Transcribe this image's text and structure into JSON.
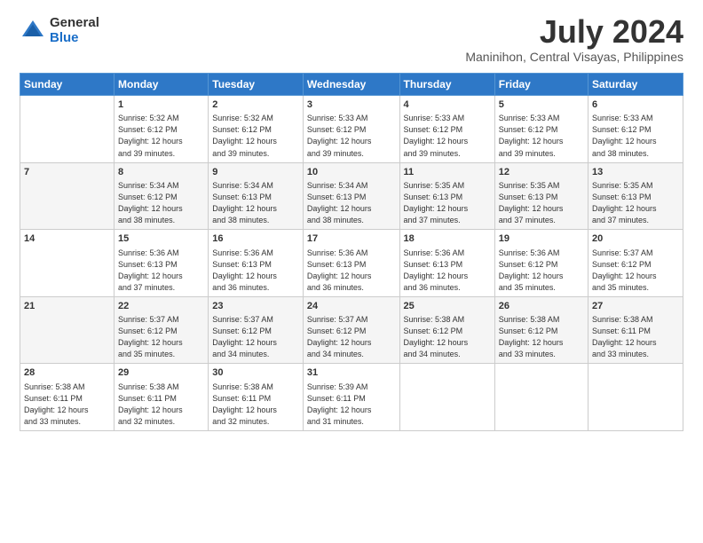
{
  "logo": {
    "general": "General",
    "blue": "Blue"
  },
  "title": {
    "month": "July 2024",
    "location": "Maninihon, Central Visayas, Philippines"
  },
  "headers": [
    "Sunday",
    "Monday",
    "Tuesday",
    "Wednesday",
    "Thursday",
    "Friday",
    "Saturday"
  ],
  "weeks": [
    [
      {
        "day": "",
        "info": ""
      },
      {
        "day": "1",
        "info": "Sunrise: 5:32 AM\nSunset: 6:12 PM\nDaylight: 12 hours\nand 39 minutes."
      },
      {
        "day": "2",
        "info": "Sunrise: 5:32 AM\nSunset: 6:12 PM\nDaylight: 12 hours\nand 39 minutes."
      },
      {
        "day": "3",
        "info": "Sunrise: 5:33 AM\nSunset: 6:12 PM\nDaylight: 12 hours\nand 39 minutes."
      },
      {
        "day": "4",
        "info": "Sunrise: 5:33 AM\nSunset: 6:12 PM\nDaylight: 12 hours\nand 39 minutes."
      },
      {
        "day": "5",
        "info": "Sunrise: 5:33 AM\nSunset: 6:12 PM\nDaylight: 12 hours\nand 39 minutes."
      },
      {
        "day": "6",
        "info": "Sunrise: 5:33 AM\nSunset: 6:12 PM\nDaylight: 12 hours\nand 38 minutes."
      }
    ],
    [
      {
        "day": "7",
        "info": ""
      },
      {
        "day": "8",
        "info": "Sunrise: 5:34 AM\nSunset: 6:12 PM\nDaylight: 12 hours\nand 38 minutes."
      },
      {
        "day": "9",
        "info": "Sunrise: 5:34 AM\nSunset: 6:13 PM\nDaylight: 12 hours\nand 38 minutes."
      },
      {
        "day": "10",
        "info": "Sunrise: 5:34 AM\nSunset: 6:13 PM\nDaylight: 12 hours\nand 38 minutes."
      },
      {
        "day": "11",
        "info": "Sunrise: 5:35 AM\nSunset: 6:13 PM\nDaylight: 12 hours\nand 37 minutes."
      },
      {
        "day": "12",
        "info": "Sunrise: 5:35 AM\nSunset: 6:13 PM\nDaylight: 12 hours\nand 37 minutes."
      },
      {
        "day": "13",
        "info": "Sunrise: 5:35 AM\nSunset: 6:13 PM\nDaylight: 12 hours\nand 37 minutes."
      }
    ],
    [
      {
        "day": "14",
        "info": ""
      },
      {
        "day": "15",
        "info": "Sunrise: 5:36 AM\nSunset: 6:13 PM\nDaylight: 12 hours\nand 37 minutes."
      },
      {
        "day": "16",
        "info": "Sunrise: 5:36 AM\nSunset: 6:13 PM\nDaylight: 12 hours\nand 36 minutes."
      },
      {
        "day": "17",
        "info": "Sunrise: 5:36 AM\nSunset: 6:13 PM\nDaylight: 12 hours\nand 36 minutes."
      },
      {
        "day": "18",
        "info": "Sunrise: 5:36 AM\nSunset: 6:13 PM\nDaylight: 12 hours\nand 36 minutes."
      },
      {
        "day": "19",
        "info": "Sunrise: 5:36 AM\nSunset: 6:12 PM\nDaylight: 12 hours\nand 35 minutes."
      },
      {
        "day": "20",
        "info": "Sunrise: 5:37 AM\nSunset: 6:12 PM\nDaylight: 12 hours\nand 35 minutes."
      }
    ],
    [
      {
        "day": "21",
        "info": ""
      },
      {
        "day": "22",
        "info": "Sunrise: 5:37 AM\nSunset: 6:12 PM\nDaylight: 12 hours\nand 35 minutes."
      },
      {
        "day": "23",
        "info": "Sunrise: 5:37 AM\nSunset: 6:12 PM\nDaylight: 12 hours\nand 34 minutes."
      },
      {
        "day": "24",
        "info": "Sunrise: 5:37 AM\nSunset: 6:12 PM\nDaylight: 12 hours\nand 34 minutes."
      },
      {
        "day": "25",
        "info": "Sunrise: 5:38 AM\nSunset: 6:12 PM\nDaylight: 12 hours\nand 34 minutes."
      },
      {
        "day": "26",
        "info": "Sunrise: 5:38 AM\nSunset: 6:12 PM\nDaylight: 12 hours\nand 33 minutes."
      },
      {
        "day": "27",
        "info": "Sunrise: 5:38 AM\nSunset: 6:11 PM\nDaylight: 12 hours\nand 33 minutes."
      }
    ],
    [
      {
        "day": "28",
        "info": "Sunrise: 5:38 AM\nSunset: 6:11 PM\nDaylight: 12 hours\nand 33 minutes."
      },
      {
        "day": "29",
        "info": "Sunrise: 5:38 AM\nSunset: 6:11 PM\nDaylight: 12 hours\nand 32 minutes."
      },
      {
        "day": "30",
        "info": "Sunrise: 5:38 AM\nSunset: 6:11 PM\nDaylight: 12 hours\nand 32 minutes."
      },
      {
        "day": "31",
        "info": "Sunrise: 5:39 AM\nSunset: 6:11 PM\nDaylight: 12 hours\nand 31 minutes."
      },
      {
        "day": "",
        "info": ""
      },
      {
        "day": "",
        "info": ""
      },
      {
        "day": "",
        "info": ""
      }
    ]
  ]
}
